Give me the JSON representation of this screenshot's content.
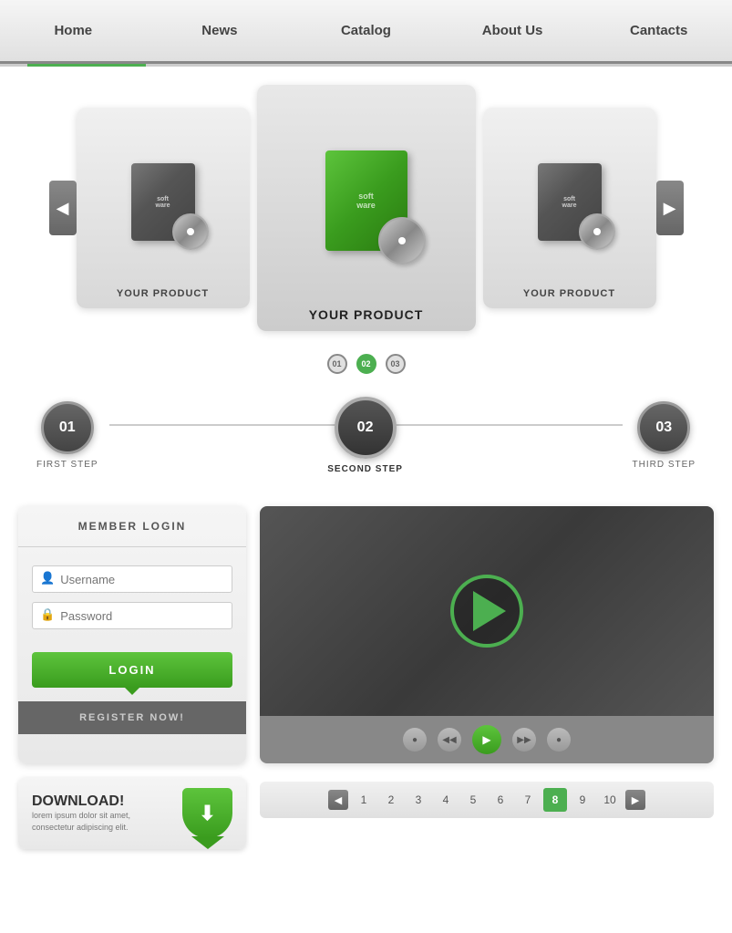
{
  "nav": {
    "items": [
      {
        "label": "Home",
        "active": true
      },
      {
        "label": "News",
        "active": false
      },
      {
        "label": "Catalog",
        "active": false
      },
      {
        "label": "About Us",
        "active": false
      },
      {
        "label": "Cantacts",
        "active": false
      }
    ]
  },
  "carousel": {
    "prev_label": "◀",
    "next_label": "▶",
    "products": [
      {
        "label": "YOUR PRODUCT",
        "size": "small"
      },
      {
        "label": "YOUR PRODUCT",
        "size": "large"
      },
      {
        "label": "YOUR PRODUCT",
        "size": "small"
      }
    ],
    "dots": [
      "01",
      "02",
      "03"
    ],
    "active_dot": 1
  },
  "steps": [
    {
      "num": "01",
      "label": "FIRST STEP",
      "active": false
    },
    {
      "num": "02",
      "label": "SECOND STEP",
      "active": true
    },
    {
      "num": "03",
      "label": "THIRD STEP",
      "active": false
    }
  ],
  "login": {
    "title": "MEMBER LOGIN",
    "username_placeholder": "Username",
    "password_placeholder": "Password",
    "button_label": "LOGIN",
    "register_label": "REGISTER NOW!"
  },
  "video": {
    "controls": [
      "●",
      "◀◀",
      "▶",
      "▶▶",
      "●"
    ]
  },
  "download": {
    "title": "DOWNLOAD!",
    "description": "lorem ipsum dolor sit amet, consectetur adipiscing elit."
  },
  "pagination": {
    "prev": "◀",
    "next": "▶",
    "pages": [
      "1",
      "2",
      "3",
      "4",
      "5",
      "6",
      "7",
      "8",
      "9",
      "10"
    ],
    "active_page": 7
  },
  "colors": {
    "green": "#4caf50",
    "dark_green": "#3a9c1e",
    "nav_bg": "#e8e8e8",
    "gray": "#888888"
  }
}
